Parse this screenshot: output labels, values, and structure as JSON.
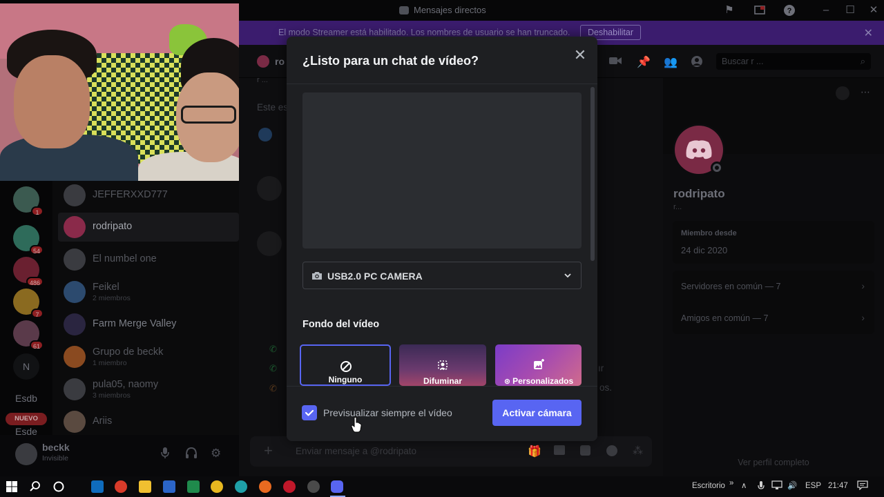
{
  "window": {
    "title": "Mensajes directos"
  },
  "banner": {
    "message": "El modo Streamer está habilitado. Los nombres de usuario se han truncado.",
    "button": "Deshabilitar"
  },
  "rail": {
    "badges": [
      "1",
      "54",
      "486",
      "7",
      "61"
    ],
    "letter_server": "N",
    "text_server": "Esdb",
    "new_pill": "NUEVO",
    "text_server2": "Esde"
  },
  "dm_list": [
    {
      "name": "JEFFERXXD777",
      "sub": ""
    },
    {
      "name": "rodripato",
      "sub": ""
    },
    {
      "name": "El numbel one",
      "sub": ""
    },
    {
      "name": "Feikel",
      "sub": "2 miembros"
    },
    {
      "name": "Farm Merge Valley",
      "sub": ""
    },
    {
      "name": "Grupo de beckk",
      "sub": "1 miembro"
    },
    {
      "name": "pula05, naomy",
      "sub": "3 miembros"
    },
    {
      "name": "Ariis",
      "sub": ""
    }
  ],
  "user": {
    "name": "beckk",
    "status": "Invisible"
  },
  "chat": {
    "header_name": "ro",
    "subheader": "r ...",
    "intro": "Este es",
    "search_placeholder": "Buscar r ...",
    "composer_placeholder": "Enviar mensaje a @rodripato",
    "fragment1": "ır",
    "fragment2": "os."
  },
  "profile": {
    "name": "rodripato",
    "handle": "r...",
    "member_since_label": "Miembro desde",
    "member_since": "24 dic 2020",
    "mutual_servers": "Servidores en común — 7",
    "mutual_friends": "Amigos en común — 7",
    "footer": "Ver perfil completo"
  },
  "modal": {
    "title": "¿Listo para un chat de vídeo?",
    "camera_selected": "USB2.0 PC CAMERA",
    "background_title": "Fondo del vídeo",
    "options": [
      "Ninguno",
      "Difuminar",
      "Personalizados"
    ],
    "selected_option": "Ninguno",
    "always_preview_label": "Previsualizar siempre el vídeo",
    "always_preview_checked": true,
    "primary_button": "Activar cámara"
  },
  "taskbar": {
    "desktop_label": "Escritorio",
    "language": "ESP",
    "time": "21:47"
  },
  "colors": {
    "accent": "#5865f2",
    "modal_bg": "#1e1f22",
    "banner_bg": "#3b1c6e",
    "badge_red": "#8e1f22"
  }
}
